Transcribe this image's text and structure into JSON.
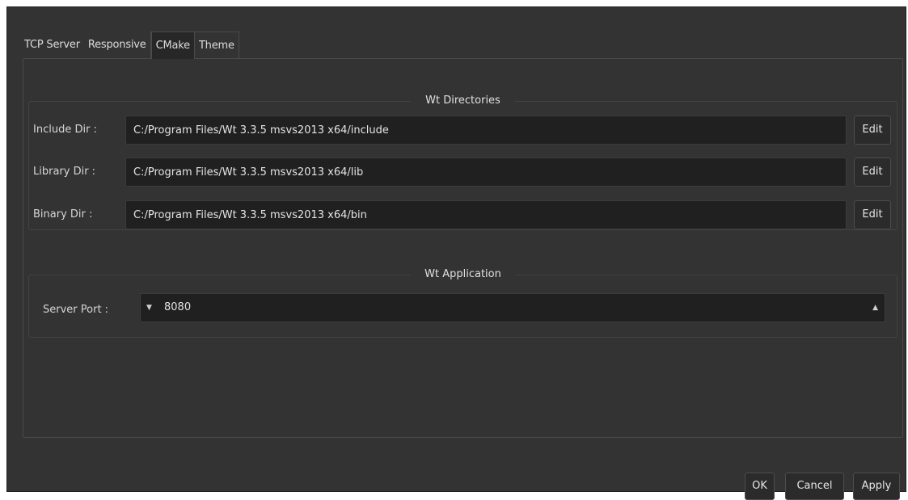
{
  "tabs": [
    {
      "label": "TCP Server"
    },
    {
      "label": "Responsive"
    },
    {
      "label": "CMake"
    },
    {
      "label": "Theme"
    }
  ],
  "directories": {
    "title": "Wt Directories",
    "rows": [
      {
        "label": "Include Dir :",
        "value": "C:/Program Files/Wt 3.3.5 msvs2013 x64/include",
        "button": "Edit"
      },
      {
        "label": "Library Dir :",
        "value": "C:/Program Files/Wt 3.3.5 msvs2013 x64/lib",
        "button": "Edit"
      },
      {
        "label": "Binary Dir :",
        "value": "C:/Program Files/Wt 3.3.5 msvs2013 x64/bin",
        "button": "Edit"
      }
    ]
  },
  "application": {
    "title": "Wt Application",
    "port_label": "Server Port :",
    "port_value": "8080",
    "down_arrow": "▼",
    "up_arrow": "▲"
  },
  "footer": {
    "ok": "OK",
    "cancel": "Cancel",
    "apply": "Apply"
  },
  "colors": {
    "window_bg": "#333333",
    "field_bg": "#202020",
    "border": "#4a4a4a"
  }
}
